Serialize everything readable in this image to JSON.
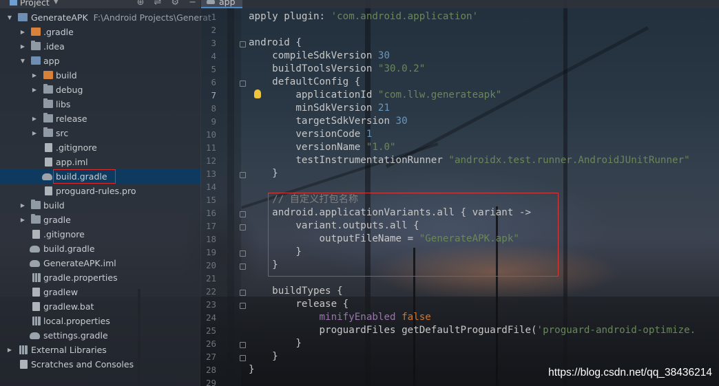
{
  "project_panel": {
    "title": "Project",
    "root_name": "GenerateAPK",
    "root_path": "F:\\Android Projects\\Generat",
    "items": [
      {
        "label": ".gradle",
        "type": "folder-orange",
        "expandable": true
      },
      {
        "label": ".idea",
        "type": "folder",
        "expandable": true
      },
      {
        "label": "app",
        "type": "module",
        "expandable": true,
        "expanded": true
      },
      {
        "label": "build",
        "type": "folder-orange",
        "expandable": true
      },
      {
        "label": "debug",
        "type": "folder",
        "expandable": true
      },
      {
        "label": "libs",
        "type": "folder",
        "expandable": false
      },
      {
        "label": "release",
        "type": "folder",
        "expandable": true
      },
      {
        "label": "src",
        "type": "folder",
        "expandable": true
      },
      {
        "label": ".gitignore",
        "type": "file"
      },
      {
        "label": "app.iml",
        "type": "file"
      },
      {
        "label": "build.gradle",
        "type": "gradle",
        "selected": true
      },
      {
        "label": "proguard-rules.pro",
        "type": "file"
      },
      {
        "label": "build",
        "type": "folder",
        "expandable": true
      },
      {
        "label": "gradle",
        "type": "folder",
        "expandable": true
      },
      {
        "label": ".gitignore",
        "type": "file"
      },
      {
        "label": "build.gradle",
        "type": "gradle"
      },
      {
        "label": "GenerateAPK.iml",
        "type": "gradle"
      },
      {
        "label": "gradle.properties",
        "type": "bars"
      },
      {
        "label": "gradlew",
        "type": "file"
      },
      {
        "label": "gradlew.bat",
        "type": "file"
      },
      {
        "label": "local.properties",
        "type": "bars"
      },
      {
        "label": "settings.gradle",
        "type": "gradle"
      },
      {
        "label": "External Libraries",
        "type": "bars",
        "expandable": true
      },
      {
        "label": "Scratches and Consoles",
        "type": "file"
      }
    ]
  },
  "editor": {
    "tab_label": "app",
    "current_line": "7",
    "line_numbers": [
      "1",
      "2",
      "3",
      "4",
      "5",
      "6",
      "7",
      "8",
      "9",
      "10",
      "11",
      "12",
      "13",
      "14",
      "15",
      "16",
      "17",
      "18",
      "19",
      "20",
      "21",
      "22",
      "23",
      "24",
      "25",
      "26",
      "27",
      "28",
      "29"
    ],
    "code": {
      "l1a": "apply plugin: ",
      "l1b": "'com.android.application'",
      "l3": "android {",
      "l4a": "    compileSdkVersion ",
      "l4b": "30",
      "l5a": "    buildToolsVersion ",
      "l5b": "\"30.0.2\"",
      "l6": "    defaultConfig {",
      "l7a": "        applicationId ",
      "l7b": "\"com.llw.generateapk\"",
      "l8a": "        minSdkVersion ",
      "l8b": "21",
      "l9a": "        targetSdkVersion ",
      "l9b": "30",
      "l10a": "        versionCode ",
      "l10b": "1",
      "l11a": "        versionName ",
      "l11b": "\"1.0\"",
      "l12a": "        testInstrumentationRunner ",
      "l12b": "\"androidx.test.runner.AndroidJUnitRunner\"",
      "l13": "    }",
      "l15": "    // 自定义打包名称",
      "l16": "    android.applicationVariants.all { variant ->",
      "l17": "        variant.outputs.all {",
      "l18a": "            outputFileName = ",
      "l18b": "\"GenerateAPK.apk\"",
      "l19": "        }",
      "l20": "    }",
      "l22": "    buildTypes {",
      "l23": "        release {",
      "l24a": "            minifyEnabled ",
      "l24b": "false",
      "l25a": "            proguardFiles getDefaultProguardFile(",
      "l25b": "'proguard-android-optimize.",
      "l26": "        }",
      "l27": "    }",
      "l28": "}"
    }
  },
  "watermark": "https://blog.csdn.net/qq_38436214",
  "colors": {
    "keyword": "#cc7832",
    "string": "#6a8759",
    "number": "#6897bb",
    "property": "#9876aa",
    "comment": "#808080",
    "annotation_box": "#e02b2b"
  }
}
